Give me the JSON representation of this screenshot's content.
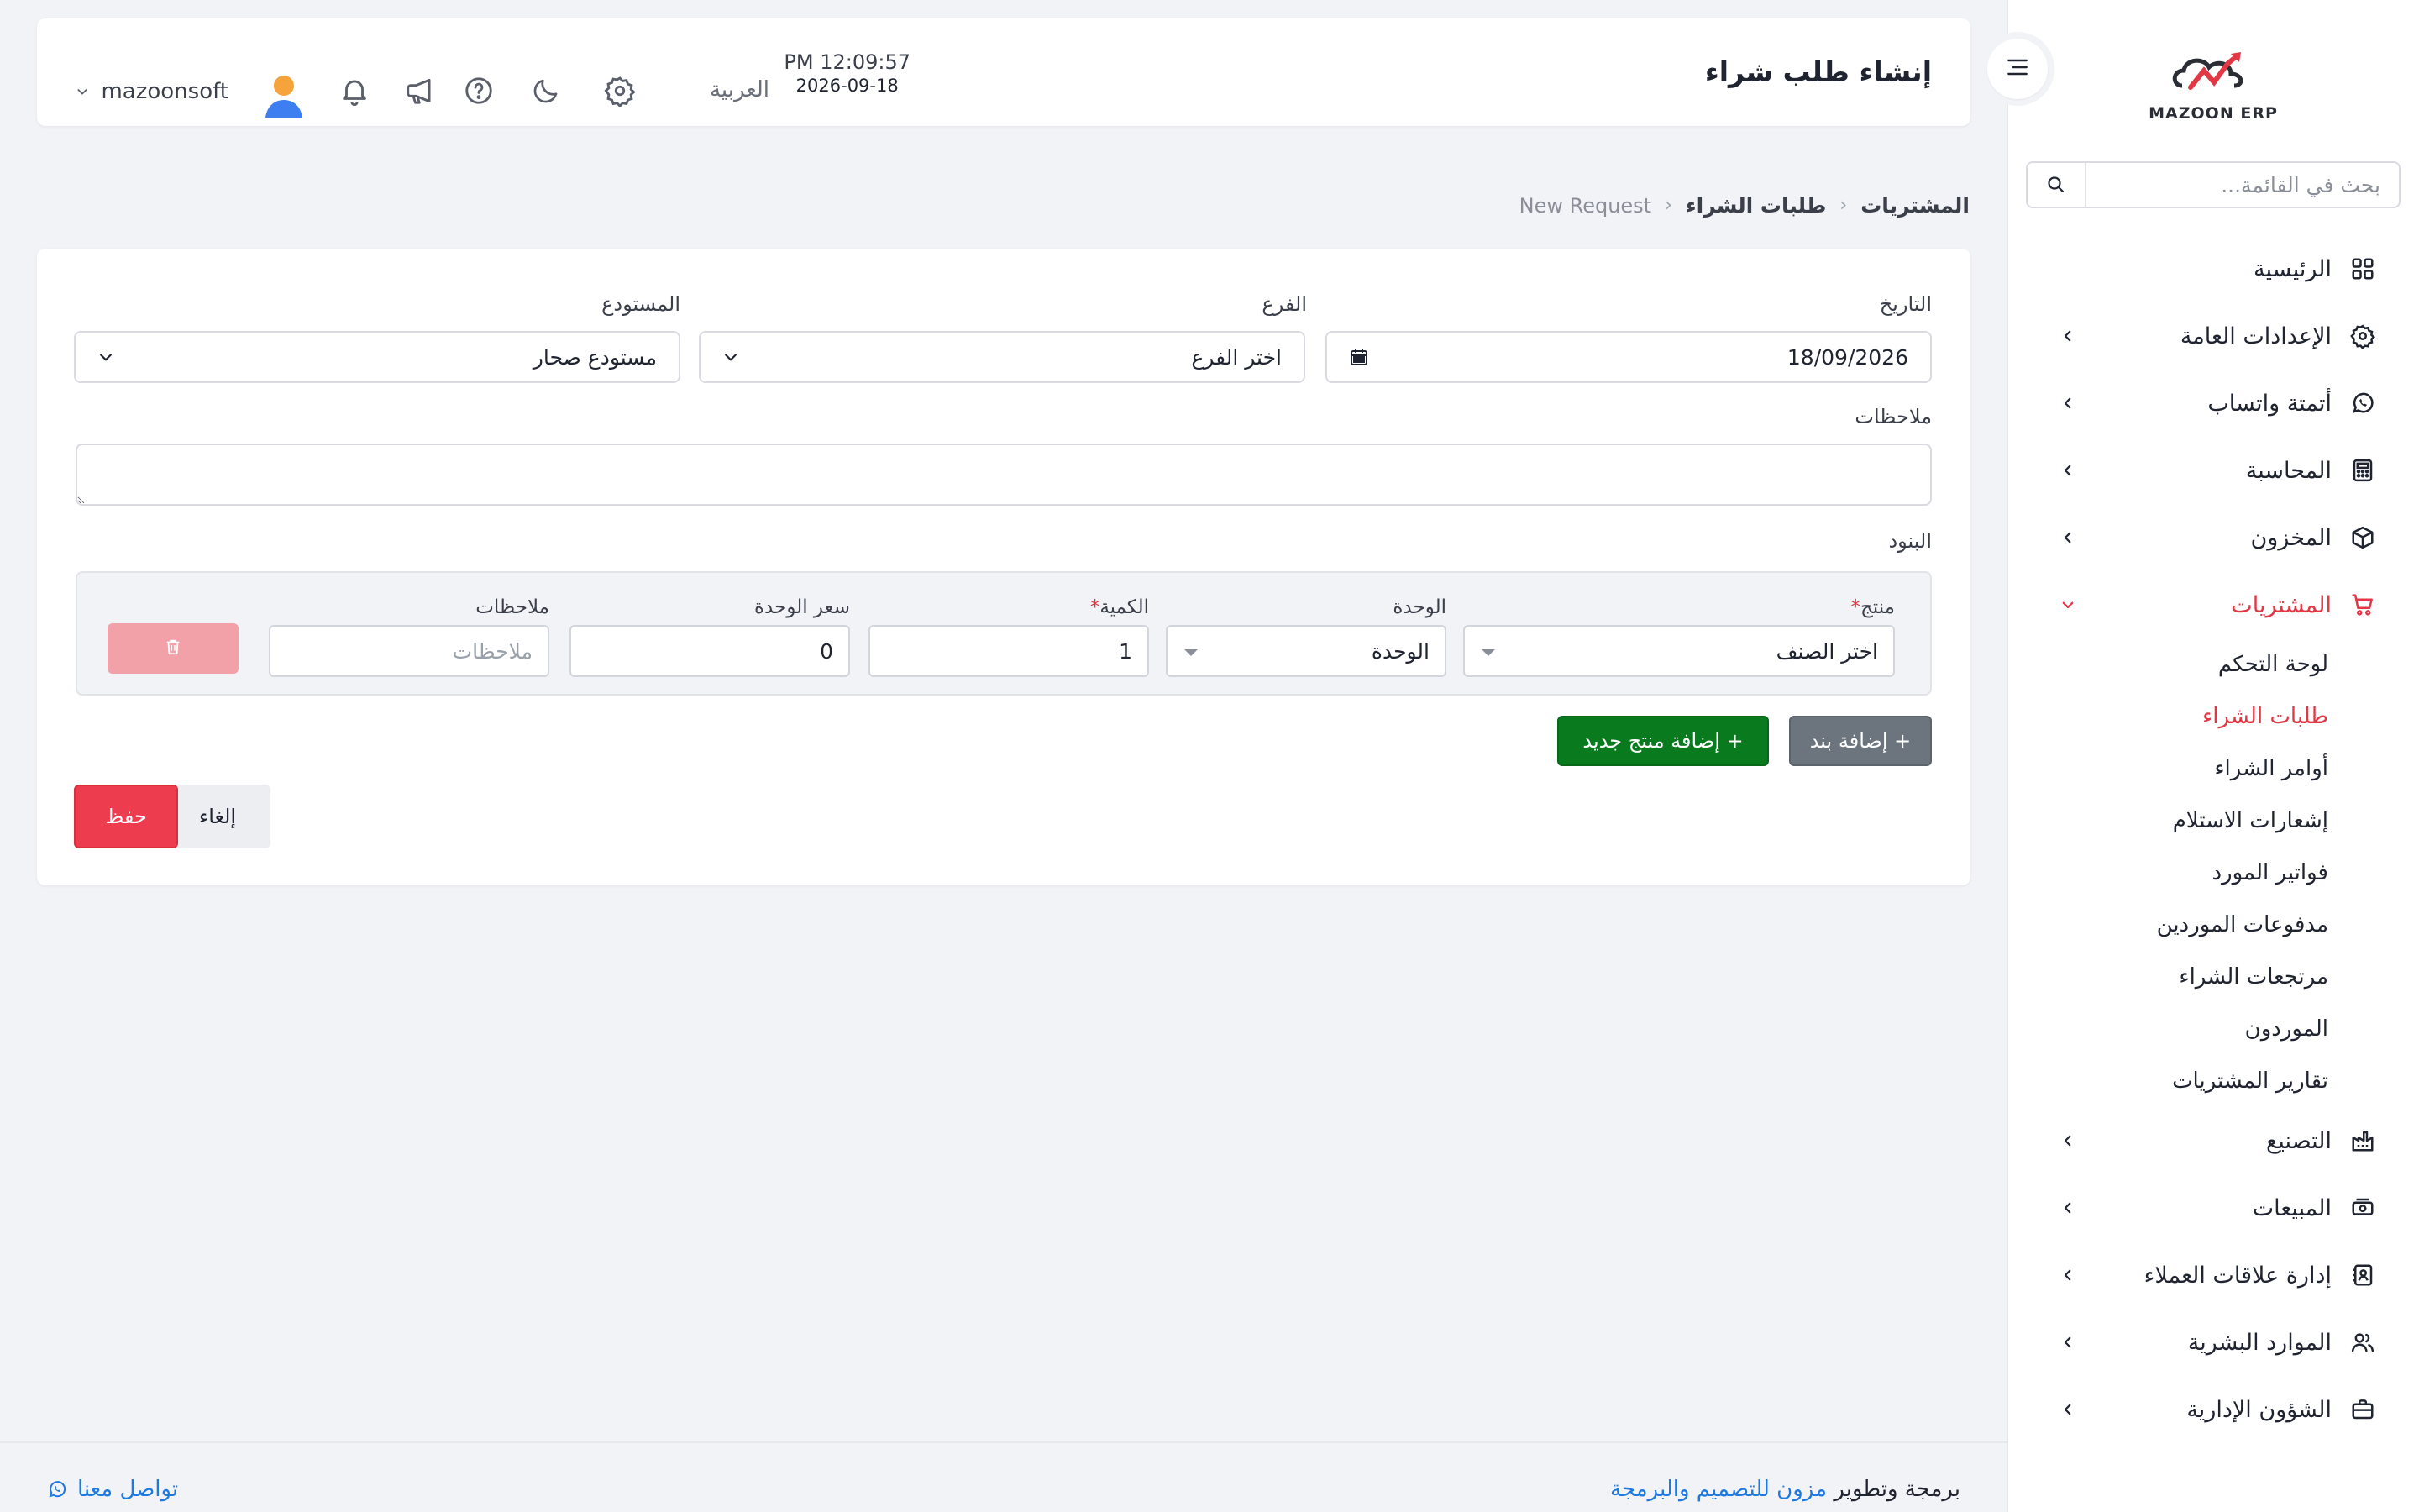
{
  "sidebar": {
    "logo_text": "MAZOON ERP",
    "search_placeholder": "بحث في القائمة...",
    "items": [
      {
        "label": "الرئيسية"
      },
      {
        "label": "الإعدادات العامة"
      },
      {
        "label": "أتمتة واتساب"
      },
      {
        "label": "المحاسبة"
      },
      {
        "label": "المخزون"
      },
      {
        "label": "المشتريات"
      },
      {
        "label": "التصنيع"
      },
      {
        "label": "المبيعات"
      },
      {
        "label": "إدارة علاقات العملاء"
      },
      {
        "label": "الموارد البشرية"
      },
      {
        "label": "الشؤون الإدارية"
      }
    ],
    "submenu": [
      {
        "label": "لوحة التحكم"
      },
      {
        "label": "طلبات الشراء"
      },
      {
        "label": "أوامر الشراء"
      },
      {
        "label": "إشعارات الاستلام"
      },
      {
        "label": "فواتير المورد"
      },
      {
        "label": "مدفوعات الموردين"
      },
      {
        "label": "مرتجعات الشراء"
      },
      {
        "label": "الموردون"
      },
      {
        "label": "تقارير المشتريات"
      }
    ]
  },
  "header": {
    "title": "إنشاء طلب شراء",
    "time": "PM 12:09:57",
    "date": "2026-09-18",
    "language": "العربية",
    "username": "mazoonsoft"
  },
  "breadcrumb": {
    "level1": "المشتريات",
    "level2": "طلبات الشراء",
    "level3": "New Request"
  },
  "form": {
    "date_label": "التاريخ",
    "date_value": "18/09/2026",
    "branch_label": "الفرع",
    "branch_value": "اختر الفرع",
    "warehouse_label": "المستودع",
    "warehouse_value": "مستودع صحار",
    "notes_label": "ملاحظات",
    "items_label": "البنود"
  },
  "item_row": {
    "product_label": "منتج",
    "product_value": "اختر الصنف",
    "unit_label": "الوحدة",
    "unit_value": "الوحدة",
    "qty_label": "الكمية",
    "qty_value": "1",
    "price_label": "سعر الوحدة",
    "price_value": "0",
    "notes_label": "ملاحظات",
    "notes_placeholder": "ملاحظات"
  },
  "actions": {
    "add_line": "+ إضافة بند",
    "add_product": "+ إضافة منتج جديد",
    "cancel": "إلغاء",
    "save": "حفظ"
  },
  "footer": {
    "credit_prefix": "برمجة وتطوير",
    "credit_link": "مزون للتصميم والبرمجة",
    "contact": "تواصل معنا"
  },
  "colors": {
    "accent": "#e23744",
    "success": "#0a7a1e",
    "secondary": "#6c757d",
    "link": "#1f7ae0"
  }
}
